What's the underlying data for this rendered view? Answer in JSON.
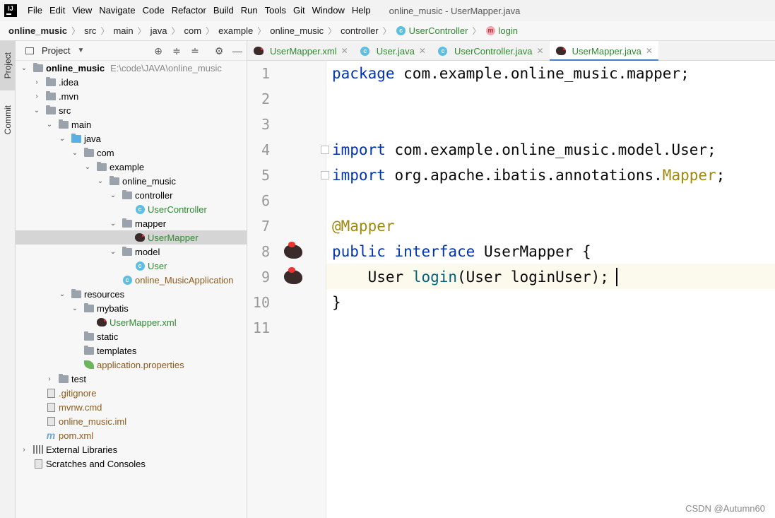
{
  "menu": {
    "logo": "IJ",
    "items": [
      "File",
      "Edit",
      "View",
      "Navigate",
      "Code",
      "Refactor",
      "Build",
      "Run",
      "Tools",
      "Git",
      "Window",
      "Help"
    ],
    "window_title": "online_music - UserMapper.java"
  },
  "breadcrumb": [
    "online_music",
    "src",
    "main",
    "java",
    "com",
    "example",
    "online_music",
    "controller",
    "UserController",
    "login"
  ],
  "toolstrip": {
    "project": "Project",
    "commit": "Commit"
  },
  "project_panel": {
    "title": "Project",
    "tree": [
      {
        "label": "online_music",
        "path": "E:\\code\\JAVA\\online_music"
      },
      {
        "label": ".idea"
      },
      {
        "label": ".mvn"
      },
      {
        "label": "src"
      },
      {
        "label": "main"
      },
      {
        "label": "java"
      },
      {
        "label": "com"
      },
      {
        "label": "example"
      },
      {
        "label": "online_music"
      },
      {
        "label": "controller"
      },
      {
        "label": "UserController"
      },
      {
        "label": "mapper"
      },
      {
        "label": "UserMapper"
      },
      {
        "label": "model"
      },
      {
        "label": "User"
      },
      {
        "label": "online_MusicApplication"
      },
      {
        "label": "resources"
      },
      {
        "label": "mybatis"
      },
      {
        "label": "UserMapper.xml"
      },
      {
        "label": "static"
      },
      {
        "label": "templates"
      },
      {
        "label": "application.properties"
      },
      {
        "label": "test"
      },
      {
        "label": ".gitignore"
      },
      {
        "label": "mvnw.cmd"
      },
      {
        "label": "online_music.iml"
      },
      {
        "label": "pom.xml"
      },
      {
        "label": "External Libraries"
      },
      {
        "label": "Scratches and Consoles"
      }
    ]
  },
  "tabs": [
    "UserMapper.xml",
    "User.java",
    "UserController.java",
    "UserMapper.java"
  ],
  "editor": {
    "line_numbers": [
      "1",
      "2",
      "3",
      "4",
      "5",
      "6",
      "7",
      "8",
      "9",
      "10",
      "11"
    ],
    "lines": {
      "l1_kw": "package",
      "l1_rest": " com.example.online_music.mapper;",
      "l4_kw": "import",
      "l4_rest": " com.example.online_music.model.User;",
      "l5_kw": "import",
      "l5_rest": " org.apache.ibatis.annotations.",
      "l5_ann": "Mapper",
      "l5_end": ";",
      "l7_ann": "@Mapper",
      "l8_kw1": "public",
      "l8_kw2": "interface",
      "l8_rest": " UserMapper {",
      "l9_type": "    User ",
      "l9_fn": "login",
      "l9_rest": "(User loginUser);",
      "l10": "}"
    }
  },
  "watermark": "CSDN @Autumn60"
}
